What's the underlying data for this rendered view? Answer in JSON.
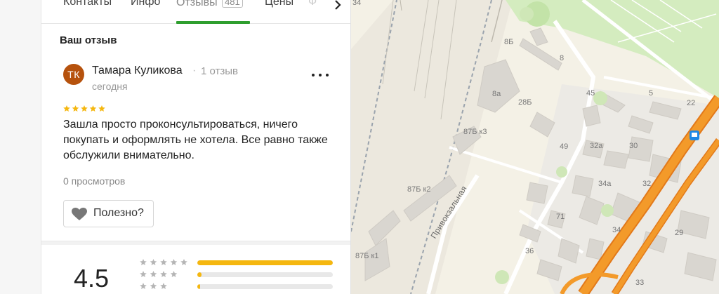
{
  "tabs": [
    {
      "label": "Контакты"
    },
    {
      "label": "Инфо"
    },
    {
      "label": "Отзывы",
      "count": "481"
    },
    {
      "label": "Цены"
    },
    {
      "label": "Ф"
    }
  ],
  "section_title": "Ваш отзыв",
  "review": {
    "avatar_initials": "ТК",
    "avatar_color": "#b6520d",
    "author": "Тамара Куликова",
    "author_reviews": "1 отзыв",
    "date": "сегодня",
    "rating": 5,
    "text": "Зашла просто проконсультироваться, ничего покупать и оформлять не хотела. Все равно также обслужили внимательно.",
    "views": "0 просмотров",
    "helpful_label": "Полезно?"
  },
  "rating_summary": {
    "value": "4.5",
    "distribution": [
      {
        "stars": 5,
        "fraction": 1.0
      },
      {
        "stars": 4,
        "fraction": 0.03
      },
      {
        "stars": 3,
        "fraction": 0.02
      }
    ]
  },
  "colors": {
    "accent_green": "#2e9e2e",
    "star_yellow": "#f5b70f",
    "road_orange": "#f28c1b"
  },
  "map": {
    "street": "Привокзальная",
    "labels": [
      "34",
      "8Б",
      "8",
      "8а",
      "28Б",
      "45",
      "5",
      "22",
      "87Б к3",
      "49",
      "32а",
      "30",
      "87Б к2",
      "34а",
      "32",
      "71",
      "34",
      "29",
      "36",
      "87Б к1",
      "33"
    ]
  }
}
